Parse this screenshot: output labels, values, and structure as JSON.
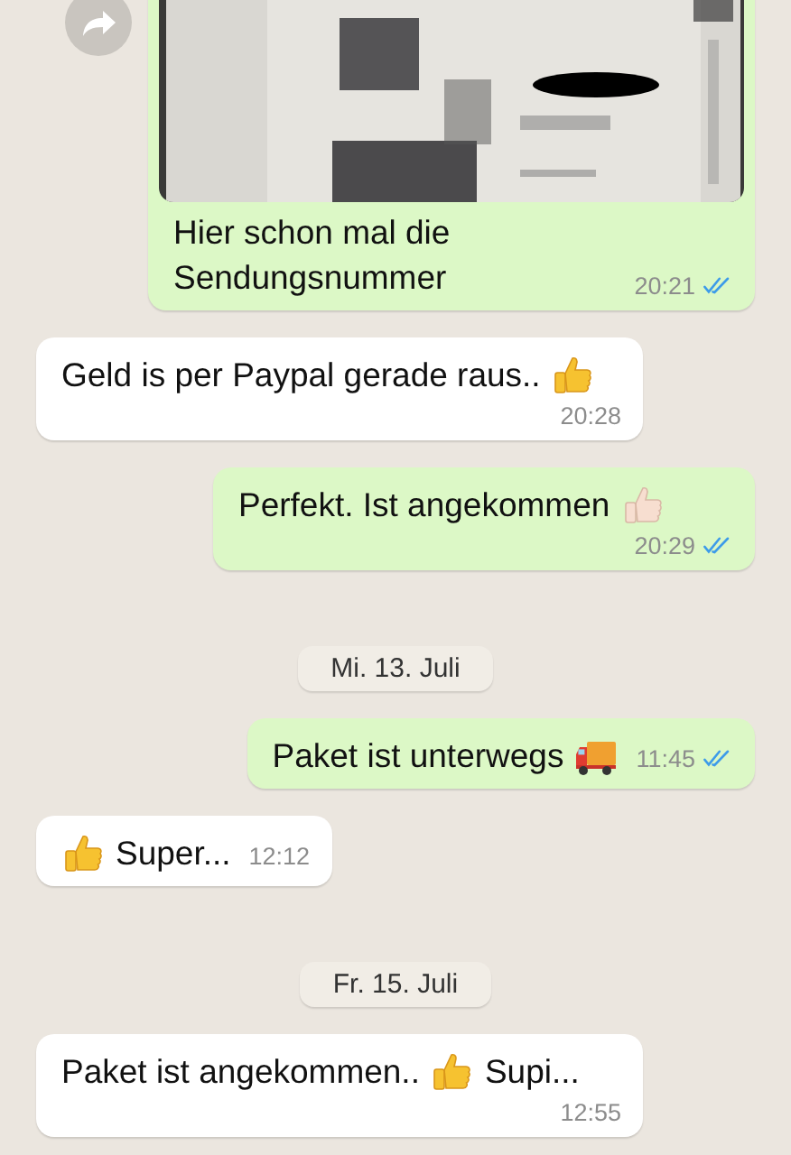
{
  "chat": [
    {
      "kind": "message",
      "outgoing": true,
      "forward_button": true,
      "attachment": {
        "kind": "picture"
      },
      "segments": [
        {
          "kind": "text",
          "text": "Hier schon mal die Sendungsnummer"
        }
      ],
      "time": "20:21",
      "read": true
    },
    {
      "kind": "message",
      "outgoing": false,
      "segments": [
        {
          "kind": "text",
          "text": "Geld is per Paypal gerade raus.."
        },
        {
          "kind": "thumb"
        }
      ],
      "time": "20:28"
    },
    {
      "kind": "message",
      "outgoing": true,
      "segments": [
        {
          "kind": "text",
          "text": "Perfekt. Ist angekommen"
        },
        {
          "kind": "thumb-light"
        }
      ],
      "time": "20:29",
      "read": true
    },
    {
      "kind": "date",
      "text": "Mi. 13. Juli"
    },
    {
      "kind": "message",
      "outgoing": true,
      "segments": [
        {
          "kind": "text",
          "text": "Paket ist unterwegs"
        },
        {
          "kind": "truck"
        }
      ],
      "time": "11:45",
      "read": true
    },
    {
      "kind": "message",
      "outgoing": false,
      "segments": [
        {
          "kind": "thumb"
        },
        {
          "kind": "text",
          "text": "Super..."
        }
      ],
      "time": "12:12"
    },
    {
      "kind": "date",
      "text": "Fr. 15. Juli"
    },
    {
      "kind": "message",
      "outgoing": false,
      "segments": [
        {
          "kind": "text",
          "text": "Paket ist angekommen.."
        },
        {
          "kind": "thumb"
        },
        {
          "kind": "text",
          "text": "Supi..."
        }
      ],
      "time": "12:55"
    }
  ]
}
